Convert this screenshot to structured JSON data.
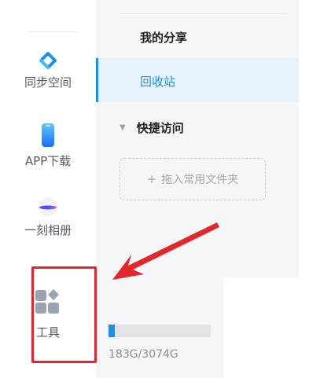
{
  "rail": {
    "items": [
      {
        "label": "同步空间",
        "icon": "sync-space-icon"
      },
      {
        "label": "APP下载",
        "icon": "phone-icon"
      },
      {
        "label": "一刻相册",
        "icon": "album-icon"
      },
      {
        "label": "工具",
        "icon": "tools-icon"
      }
    ]
  },
  "panel": {
    "nav": {
      "share": "我的分享",
      "recycle": "回收站"
    },
    "quick_access": {
      "label": "快捷访问",
      "drop_zone": "拖入常用文件夹"
    }
  },
  "storage": {
    "text": "183G/3074G",
    "used_fraction": 0.06
  },
  "colors": {
    "accent": "#1b8ef2",
    "highlight": "#e3262b"
  }
}
